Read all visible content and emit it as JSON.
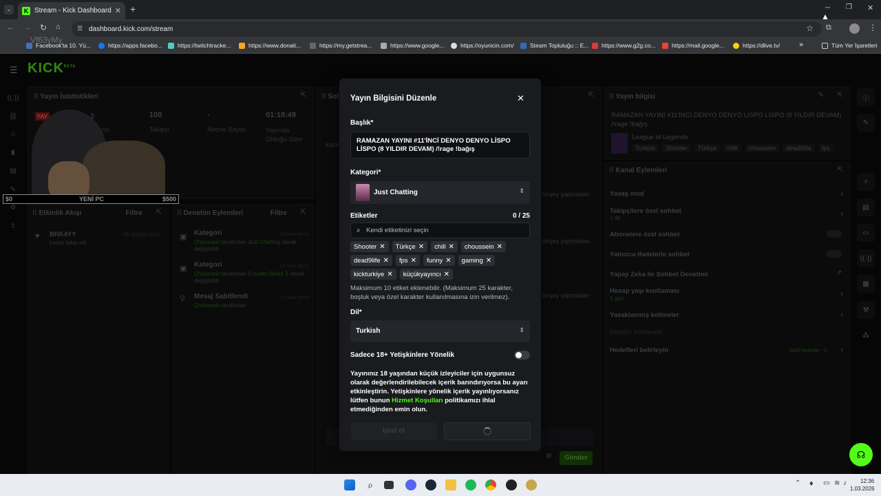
{
  "browser": {
    "tab_title": "Stream - Kick Dashboard",
    "url": "dashboard.kick.com/stream",
    "bookmarks": [
      "Facebook'ta 10. Yü...",
      "https://apps.facebo...",
      "https://twitchtracke...",
      "https://www.donati...",
      "https://my.getstrea...",
      "https://www.google...",
      "https://oyunicin.com/",
      "Steam Topluluğu :: E...",
      "https://www.g2g.co...",
      "https://mail.google...",
      "https://dlive.tv/"
    ],
    "all_bookmarks": "Tüm Yer İşaretleri",
    "more": "»"
  },
  "overlay_text": {
    "money_left": "$0",
    "money_mid": "YENİ PC",
    "money_right": "$500",
    "watermark": "Vf63yMy"
  },
  "dashboard": {
    "logo": "KICK",
    "logo_beta": "BETA",
    "stats": {
      "title": "Yayın İstatistikleri",
      "prefix": "YAY",
      "viewers_partial": "2",
      "viewers_label": "leyici",
      "followers": "100",
      "followers_label": "Takipçi",
      "subs": "-",
      "subs_label": "Abone Sayısı",
      "duration": "01:18:49",
      "duration_label": "Yayında Olduğu Süre"
    },
    "activity": {
      "title": "Etkinlik Akışı",
      "filter": "Filtre",
      "user": "BRK4YY",
      "action": "kanalı takip etti",
      "time": "48 dakika önce"
    },
    "moderation": {
      "title": "Denetim Eylemleri",
      "filter": "Filtre",
      "items": [
        {
          "title": "Kategori",
          "time": "11 saat önce",
          "user": "Choussein",
          "mid": " tarafından ",
          "target": "Just Chatting",
          "end": " olarak değiştirildi"
        },
        {
          "title": "Kategori",
          "time": "13 saat önce",
          "user": "Choussein",
          "mid": " tarafından ",
          "target": "Counter-Strike 2",
          "end": " olarak değiştirildi"
        },
        {
          "title": "Mesaj Sabitlendi",
          "time": "13 saat önce",
          "user": "Choussein",
          "mid": " tarafından",
          "target": "",
          "end": ""
        }
      ]
    },
    "chat": {
      "title_partial": "Sol",
      "kaza": "kaza",
      "birsey": "birşey yapmadan",
      "send": "Gönder"
    },
    "stream_info": {
      "title": "Yayın bilgisi",
      "text": "RAMAZAN YAYINI #11'İNCİ DENYO DENYO LİSPO LİSPO (8 YILDIR DEVAM) /!rage !bağış",
      "category": "League of Legends",
      "tags": [
        "Turkish",
        "Shooter",
        "Türkçe",
        "chill",
        "choussein",
        "dead9life",
        "fps"
      ]
    },
    "channel_actions": {
      "title": "Kanal Eylemleri",
      "items": [
        {
          "label": "Yavaş mod",
          "sub": "",
          "status": ""
        },
        {
          "label": "Takipçilere özel sohbet",
          "sub": "1 dk.",
          "status": ""
        },
        {
          "label": "Abonelere özel sohbet",
          "sub": "",
          "status": ""
        },
        {
          "label": "Yalnızca ifadelerle sohbet",
          "sub": "",
          "status": ""
        },
        {
          "label": "Yapay Zeka ile Sohbet Denetimi",
          "sub": "",
          "status": ""
        },
        {
          "label": "Hesap yaşı kısıtlaması",
          "sub": "1 gün",
          "status": ""
        },
        {
          "label": "Yasaklanmış kelimeler",
          "sub": "",
          "status": ""
        },
        {
          "label": "İzleyici Yönlendir",
          "sub": "",
          "status": ""
        },
        {
          "label": "Hedefleri belirleyin",
          "sub": "",
          "status": "Aktif hedefler - 2"
        }
      ]
    }
  },
  "modal": {
    "title": "Yayın Bilgisini Düzenle",
    "title_label": "Başlık*",
    "title_value": "RAMAZAN YAYINI #11'İNCİ   DENYO DENYO LİSPO LİSPO   (8 YILDIR DEVAM)   /!rage !bağış",
    "category_label": "Kategori*",
    "category_value": "Just Chatting",
    "tags_label": "Etiketler",
    "tags_count": "0 / 25",
    "tags_placeholder": "Kendi etiketinizi seçin",
    "tags": [
      "Shooter",
      "Türkçe",
      "chill",
      "choussein",
      "dead9life",
      "fps",
      "funny",
      "gaming",
      "kickturkiye",
      "küçükyayıncı"
    ],
    "tags_hint": "Maksimum 10 etiket eklenebilir. (Maksimum 25 karakter, boşluk veya özel karakter kullanılmasına izin verilmez).",
    "lang_label": "Dil*",
    "lang_value": "Turkish",
    "adult_label": "Sadece 18+ Yetişkinlere Yönelik",
    "adult_text_1": "Yayınınız 18 yaşından küçük izleyiciler için uygunsuz olarak değerlendirilebilecek içerik barındırıyorsa bu ayarı etkinleştirin. Yetişkinlere yönelik içerik yayınlıyorsanız lütfen bunun ",
    "adult_link": "Hizmet Koşulları",
    "adult_text_2": " politikamızı ihlal etmediğinden emin olun.",
    "cancel": "İptal et"
  },
  "taskbar": {
    "time": "12:36",
    "date": "1.03.2026"
  },
  "colors": {
    "kick_green": "#53fc18",
    "modal_bg": "#191b1f"
  }
}
